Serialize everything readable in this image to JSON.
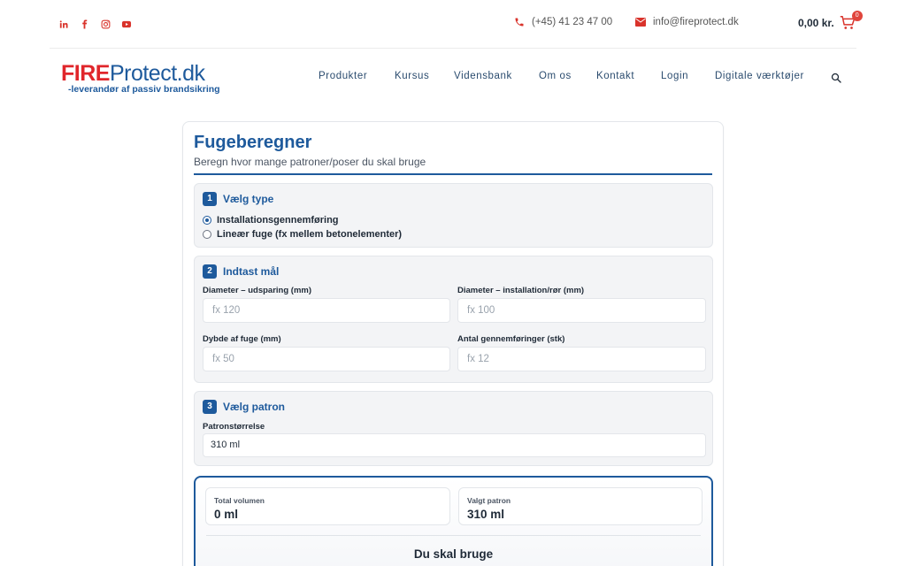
{
  "topbar": {
    "social": [
      {
        "name": "linkedin-icon",
        "glyph": "in"
      },
      {
        "name": "facebook-icon",
        "glyph": "f"
      },
      {
        "name": "instagram-icon",
        "glyph": ""
      },
      {
        "name": "youtube-icon",
        "glyph": ""
      }
    ],
    "phone": "(+45) 41 23 47 00",
    "email": "info@fireprotect.dk",
    "cart_amount": "0,00 kr.",
    "cart_count": "0"
  },
  "header": {
    "logo_fire": "FIRE",
    "logo_protect": "Protect.dk",
    "logo_tagline": "-leverandør af passiv brandsikring",
    "nav": [
      "Produkter",
      "Kursus",
      "Vidensbank",
      "Om os",
      "Kontakt",
      "Login",
      "Digitale værktøjer"
    ]
  },
  "calculator": {
    "title": "Fugeberegner",
    "subtitle": "Beregn hvor mange patroner/poser du skal bruge",
    "step1": {
      "number": "1",
      "title": "Vælg type",
      "options": [
        {
          "label": "Installationsgennemføring",
          "selected": true
        },
        {
          "label": "Lineær fuge (fx mellem betonelementer)",
          "selected": false
        }
      ]
    },
    "step2": {
      "number": "2",
      "title": "Indtast mål",
      "fields": [
        {
          "label": "Diameter – udsparing (mm)",
          "placeholder": "fx 120"
        },
        {
          "label": "Diameter – installation/rør (mm)",
          "placeholder": "fx 100"
        },
        {
          "label": "Dybde af fuge (mm)",
          "placeholder": "fx 50"
        },
        {
          "label": "Antal gennemføringer (stk)",
          "placeholder": "fx 12"
        }
      ]
    },
    "step3": {
      "number": "3",
      "title": "Vælg patron",
      "label": "Patronstørrelse",
      "selected": "310 ml"
    },
    "result": {
      "total_label": "Total volumen",
      "total_value": "0 ml",
      "patron_label": "Valgt patron",
      "patron_value": "310 ml",
      "heading": "Du skal bruge"
    }
  },
  "colors": {
    "brand_blue": "#1e5a9c",
    "brand_red": "#e0262b",
    "icon_red": "#d9332b"
  }
}
